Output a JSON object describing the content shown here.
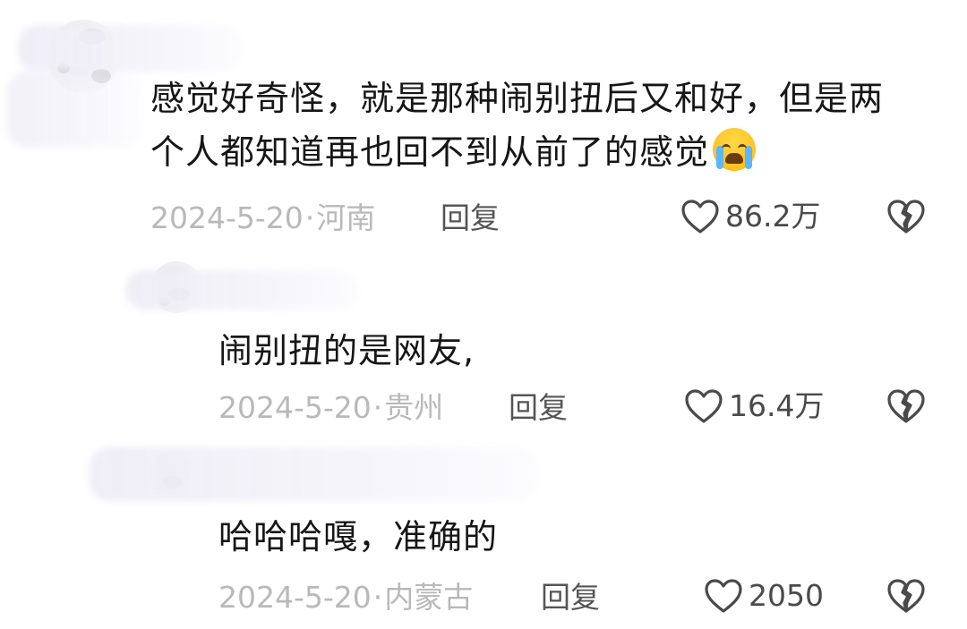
{
  "comments": [
    {
      "text_line1": "感觉好奇怪，就是那种闹别扭后又和好，但是两",
      "text_line2": "个人都知道再也回不到从前了的感觉",
      "emoji": "loudly-crying-face",
      "date": "2024-5-20",
      "separator": "·",
      "location": "河南",
      "reply_label": "回复",
      "likes": "86.2万"
    },
    {
      "text_line1": "闹别扭的是网友,",
      "date": "2024-5-20",
      "separator": "·",
      "location": "贵州",
      "reply_label": "回复",
      "likes": "16.4万"
    },
    {
      "text_line1": "哈哈哈嘎，准确的",
      "date": "2024-5-20",
      "separator": "·",
      "location": "内蒙古",
      "reply_label": "回复",
      "likes": "2050"
    }
  ],
  "icons": {
    "like": "heart-outline-icon",
    "dislike": "broken-heart-outline-icon"
  },
  "colors": {
    "meta_gray": "#b9b9b9",
    "text": "#161616",
    "icon": "#4a4a4a"
  }
}
